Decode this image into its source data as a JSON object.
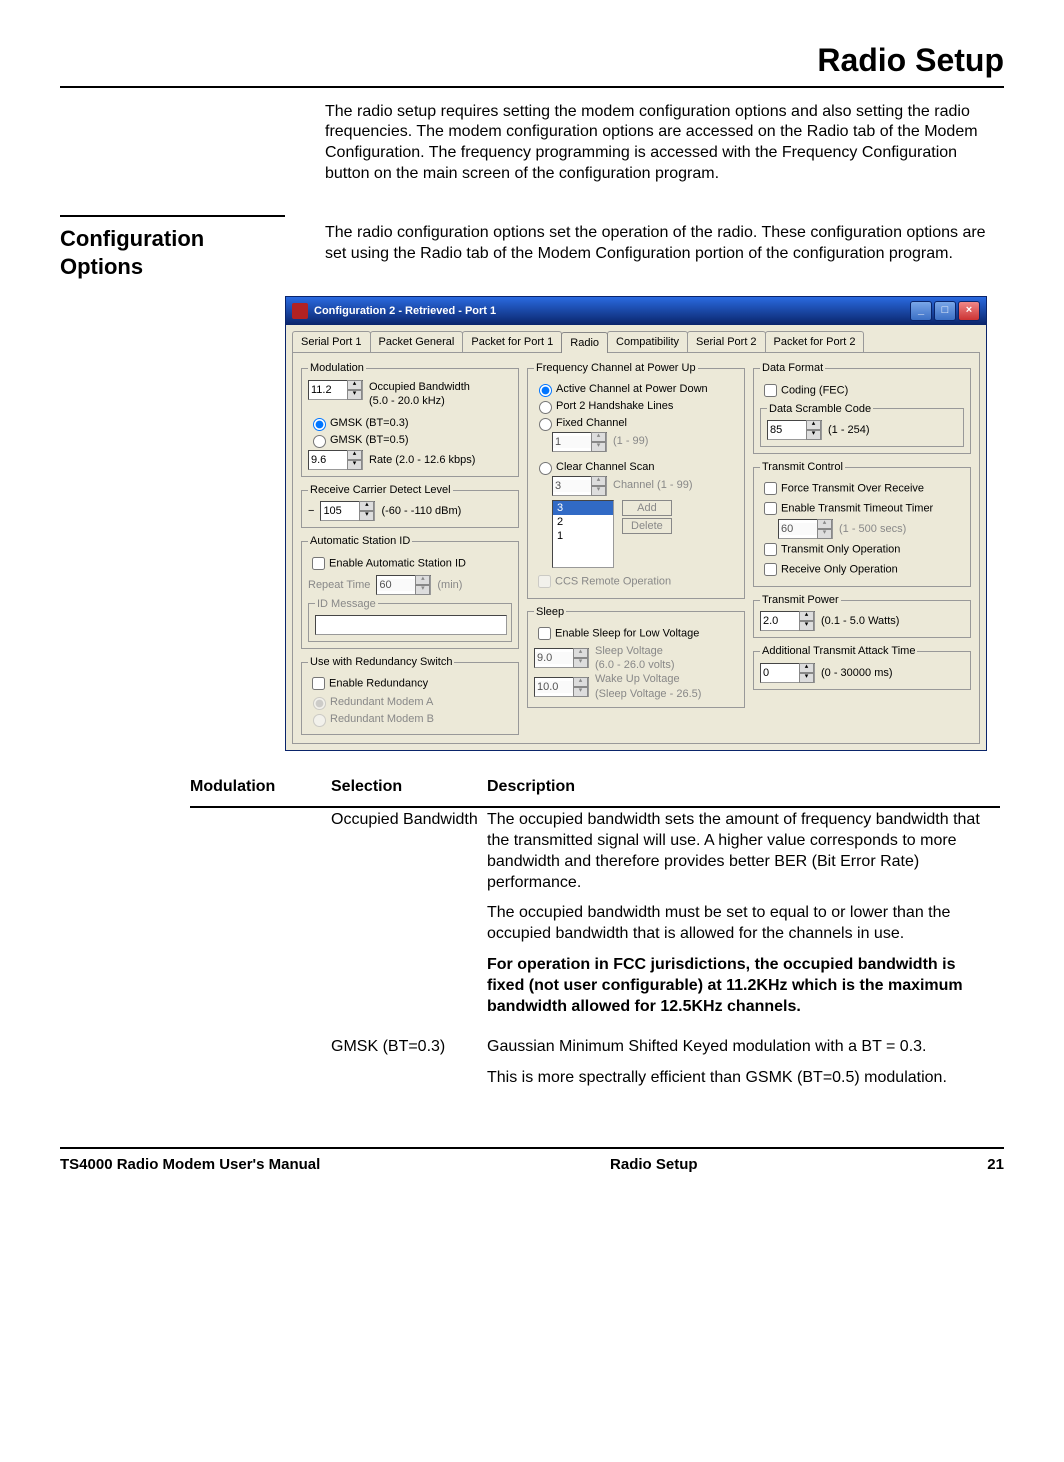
{
  "page": {
    "title": "Radio Setup",
    "intro": "The radio setup requires setting the modem configuration options and also setting the radio frequencies.  The modem configuration options are accessed on the Radio tab of the Modem Configuration.  The frequency programming is accessed with the Frequency Configuration button on the main screen of the configuration program."
  },
  "section": {
    "heading": "Configuration Options",
    "body": "The radio configuration options set the operation of the radio.  These configuration options are set using the Radio tab of the Modem Configuration portion of the configuration program."
  },
  "window": {
    "title": "Configuration 2 - Retrieved - Port 1",
    "tabs": [
      "Serial Port 1",
      "Packet General",
      "Packet for Port 1",
      "Radio",
      "Compatibility",
      "Serial Port 2",
      "Packet for Port 2"
    ],
    "active_tab": 3,
    "modulation": {
      "legend": "Modulation",
      "bandwidth_value": "11.2",
      "bandwidth_label": "Occupied Bandwidth",
      "bandwidth_range": "(5.0 - 20.0 kHz)",
      "gmsk03": "GMSK (BT=0.3)",
      "gmsk05": "GMSK (BT=0.5)",
      "rate_value": "9.6",
      "rate_label": "Rate  (2.0 - 12.6 kbps)"
    },
    "rcd": {
      "legend": "Receive Carrier Detect Level",
      "value": "105",
      "range": "(-60 - -110 dBm)"
    },
    "auto_id": {
      "legend": "Automatic Station ID",
      "enable": "Enable Automatic Station ID",
      "repeat_label": "Repeat Time",
      "repeat_value": "60",
      "repeat_unit": "(min)",
      "id_msg_legend": "ID Message"
    },
    "redundancy": {
      "legend": "Use with Redundancy Switch",
      "enable": "Enable Redundancy",
      "opt_a": "Redundant Modem A",
      "opt_b": "Redundant Modem B"
    },
    "freq": {
      "legend": "Frequency Channel at Power Up",
      "opt_active": "Active Channel at Power Down",
      "opt_port2": "Port 2 Handshake Lines",
      "opt_fixed": "Fixed Channel",
      "fixed_value": "1",
      "fixed_range": "(1 - 99)",
      "opt_ccs": "Clear Channel Scan",
      "ccs_value": "3",
      "ccs_range": "Channel  (1 - 99)",
      "list": [
        "3",
        "2",
        "1"
      ],
      "add": "Add",
      "delete": "Delete",
      "ccs_remote": "CCS Remote Operation"
    },
    "sleep": {
      "legend": "Sleep",
      "enable": "Enable Sleep for Low Voltage",
      "sleep_v": "9.0",
      "sleep_v_label": "Sleep Voltage",
      "sleep_v_range": "(6.0 - 26.0 volts)",
      "wake_v": "10.0",
      "wake_v_label": "Wake Up Voltage",
      "wake_v_range": "(Sleep Voltage  - 26.5)"
    },
    "data_format": {
      "legend": "Data Format",
      "coding": "Coding (FEC)",
      "scramble_legend": "Data Scramble Code",
      "scramble_value": "85",
      "scramble_range": "(1 - 254)"
    },
    "tx_control": {
      "legend": "Transmit Control",
      "force": "Force Transmit Over Receive",
      "enable_timer": "Enable Transmit Timeout Timer",
      "timer_value": "60",
      "timer_range": "(1 - 500 secs)",
      "tx_only": "Transmit Only Operation",
      "rx_only": "Receive Only Operation"
    },
    "tx_power": {
      "legend": "Transmit Power",
      "value": "2.0",
      "range": "(0.1 - 5.0 Watts)"
    },
    "attack": {
      "legend": "Additional Transmit Attack Time",
      "value": "0",
      "range": "(0 - 30000 ms)"
    }
  },
  "table": {
    "side_heading": "Modulation",
    "col_selection": "Selection",
    "col_description": "Description",
    "rows": [
      {
        "selection": "Occupied Bandwidth",
        "p1": "The occupied bandwidth sets the amount of frequency bandwidth that the transmitted signal will use.  A higher value corresponds to more bandwidth and therefore provides better BER (Bit Error Rate) performance.",
        "p2": "The occupied bandwidth must be set to equal to or lower than the occupied bandwidth that is allowed for the channels in use.",
        "p3": "For operation in FCC jurisdictions, the occupied bandwidth is fixed (not user configurable) at 11.2KHz which is the maximum bandwidth allowed for 12.5KHz channels."
      },
      {
        "selection": "GMSK (BT=0.3)",
        "p1": "Gaussian Minimum Shifted Keyed modulation with a BT = 0.3.",
        "p2": "This is more spectrally efficient than GSMK (BT=0.5) modulation."
      }
    ]
  },
  "footer": {
    "left": "TS4000 Radio Modem User's Manual",
    "center": "Radio Setup",
    "right": "21"
  }
}
